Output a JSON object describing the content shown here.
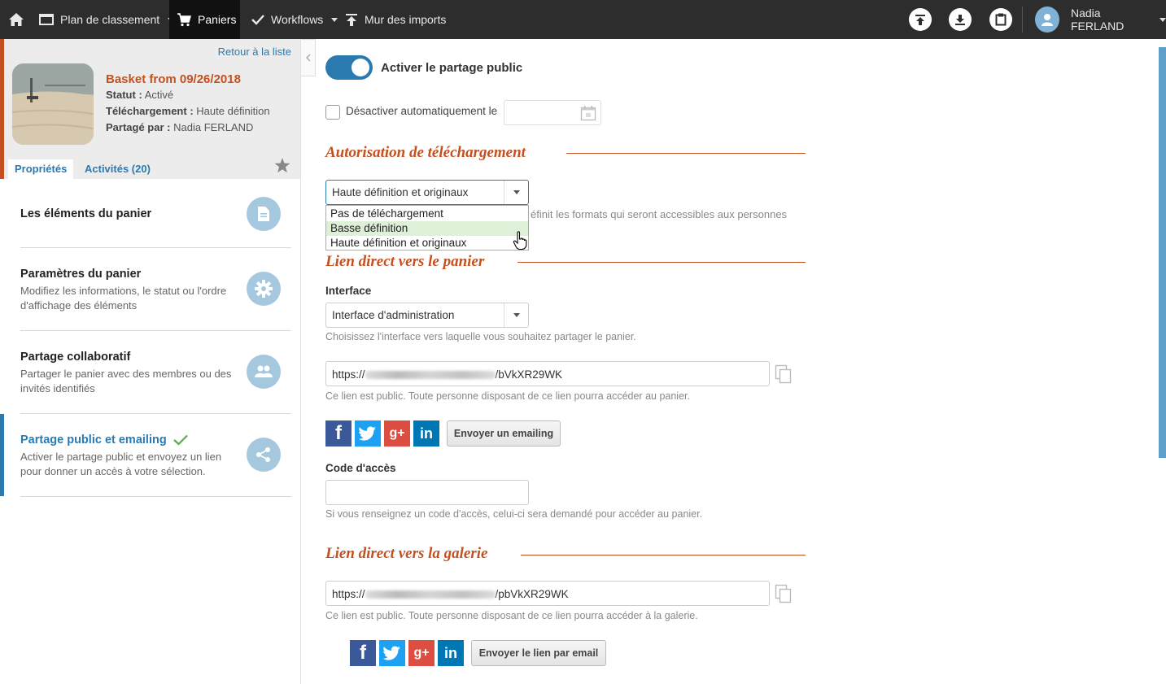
{
  "topbar": {
    "home_icon": "home-icon",
    "items": [
      {
        "label": "Plan de classement",
        "icon": "folder-icon"
      },
      {
        "label": "Paniers",
        "icon": "cart-icon"
      },
      {
        "label": "Workflows",
        "icon": "check-icon"
      },
      {
        "label": "Mur des imports",
        "icon": "upload-icon"
      }
    ],
    "user_name": "Nadia FERLAND"
  },
  "basket": {
    "back_link": "Retour à la liste",
    "title": "Basket from 09/26/2018",
    "status_label": "Statut :",
    "status_value": "Activé",
    "download_label": "Téléchargement :",
    "download_value": "Haute définition",
    "shared_label": "Partagé par :",
    "shared_value": "Nadia FERLAND",
    "tabs": [
      "Propriétés",
      "Activités (20)"
    ]
  },
  "menu": [
    {
      "title": "Les éléments du panier",
      "desc": "",
      "icon": "document-icon"
    },
    {
      "title": "Paramètres du panier",
      "desc": "Modifiez les informations, le statut ou l'ordre d'affichage des éléments",
      "icon": "gear-icon"
    },
    {
      "title": "Partage collaboratif",
      "desc": "Partager le panier avec des membres ou des invités identifiés",
      "icon": "users-icon"
    },
    {
      "title": "Partage public et emailing",
      "desc": "Activer le partage public et envoyez un lien pour donner un accès à votre sélection.",
      "icon": "share-icon"
    }
  ],
  "main": {
    "public_toggle_label": "Activer le partage public",
    "public_toggle_on": true,
    "auto_disable_label": "Désactiver automatiquement le",
    "auto_disable_checked": false,
    "section_download": "Autorisation de téléchargement",
    "download_select_value": "Haute définition et originaux",
    "download_options": [
      "Pas de téléchargement",
      "Basse définition",
      "Haute définition et originaux"
    ],
    "download_highlighted": "Basse définition",
    "download_hint_partial": "éfinit les formats qui seront accessibles aux personnes",
    "section_basket_link": "Lien direct vers le panier",
    "interface_label": "Interface",
    "interface_value": "Interface d'administration",
    "interface_hint": "Choisissez l'interface vers laquelle vous souhaitez partager le panier.",
    "basket_url_prefix": "https://",
    "basket_url_suffix": "/bVkXR29WK",
    "basket_url_hint": "Ce lien est public. Toute personne disposant de ce lien pourra accéder au panier.",
    "send_emailing_button": "Envoyer un emailing",
    "access_code_label": "Code d'accès",
    "access_code_value": "",
    "access_code_hint": "Si vous renseignez un code d'accès, celui-ci sera demandé pour accéder au panier.",
    "section_gallery_link": "Lien direct vers la galerie",
    "gallery_url_prefix": "https://",
    "gallery_url_suffix": "/pbVkXR29WK",
    "gallery_url_hint": "Ce lien est public. Toute personne disposant de ce lien pourra accéder à la galerie.",
    "send_link_button": "Envoyer le lien par email"
  },
  "social": {
    "facebook": {
      "glyph": "f",
      "color": "#3b5998"
    },
    "twitter": {
      "glyph": "t",
      "color": "#1da1f2"
    },
    "googleplus": {
      "glyph": "g+",
      "color": "#dc4e41"
    },
    "linkedin": {
      "glyph": "in",
      "color": "#0077b5"
    }
  },
  "colors": {
    "accent": "#2a7ab0",
    "brand": "#c4501f",
    "topbar": "#2d2d2d"
  }
}
